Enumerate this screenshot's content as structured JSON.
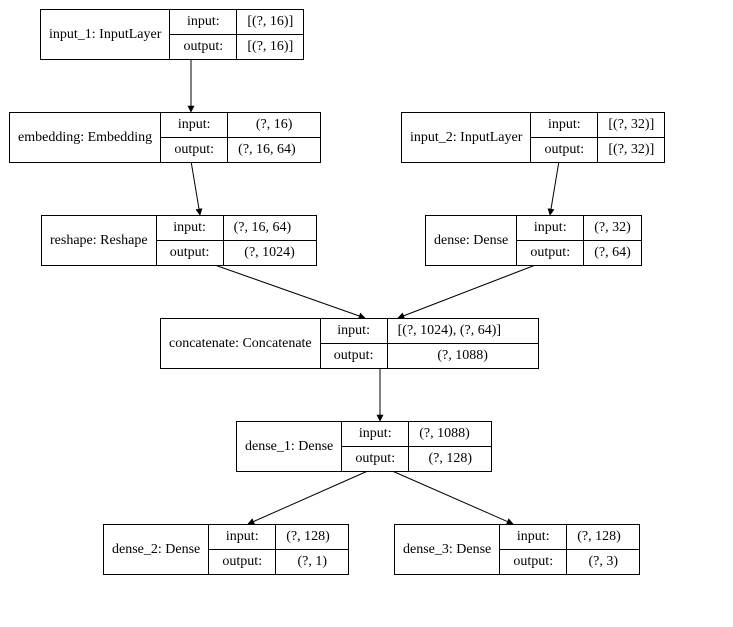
{
  "labels": {
    "input": "input:",
    "output": "output:"
  },
  "nodes": {
    "input1": {
      "name": "input_1: InputLayer",
      "in": "[(?, 16)]",
      "out": "[(?, 16)]"
    },
    "embedding": {
      "name": "embedding: Embedding",
      "in": "(?, 16)",
      "out": "(?, 16, 64)"
    },
    "input2": {
      "name": "input_2: InputLayer",
      "in": "[(?, 32)]",
      "out": "[(?, 32)]"
    },
    "reshape": {
      "name": "reshape: Reshape",
      "in": "(?, 16, 64)",
      "out": "(?, 1024)"
    },
    "dense": {
      "name": "dense: Dense",
      "in": "(?, 32)",
      "out": "(?, 64)"
    },
    "concatenate": {
      "name": "concatenate: Concatenate",
      "in": "[(?, 1024), (?, 64)]",
      "out": "(?, 1088)"
    },
    "dense1": {
      "name": "dense_1: Dense",
      "in": "(?, 1088)",
      "out": "(?, 128)"
    },
    "dense2": {
      "name": "dense_2: Dense",
      "in": "(?, 128)",
      "out": "(?, 1)"
    },
    "dense3": {
      "name": "dense_3: Dense",
      "in": "(?, 128)",
      "out": "(?, 3)"
    }
  }
}
